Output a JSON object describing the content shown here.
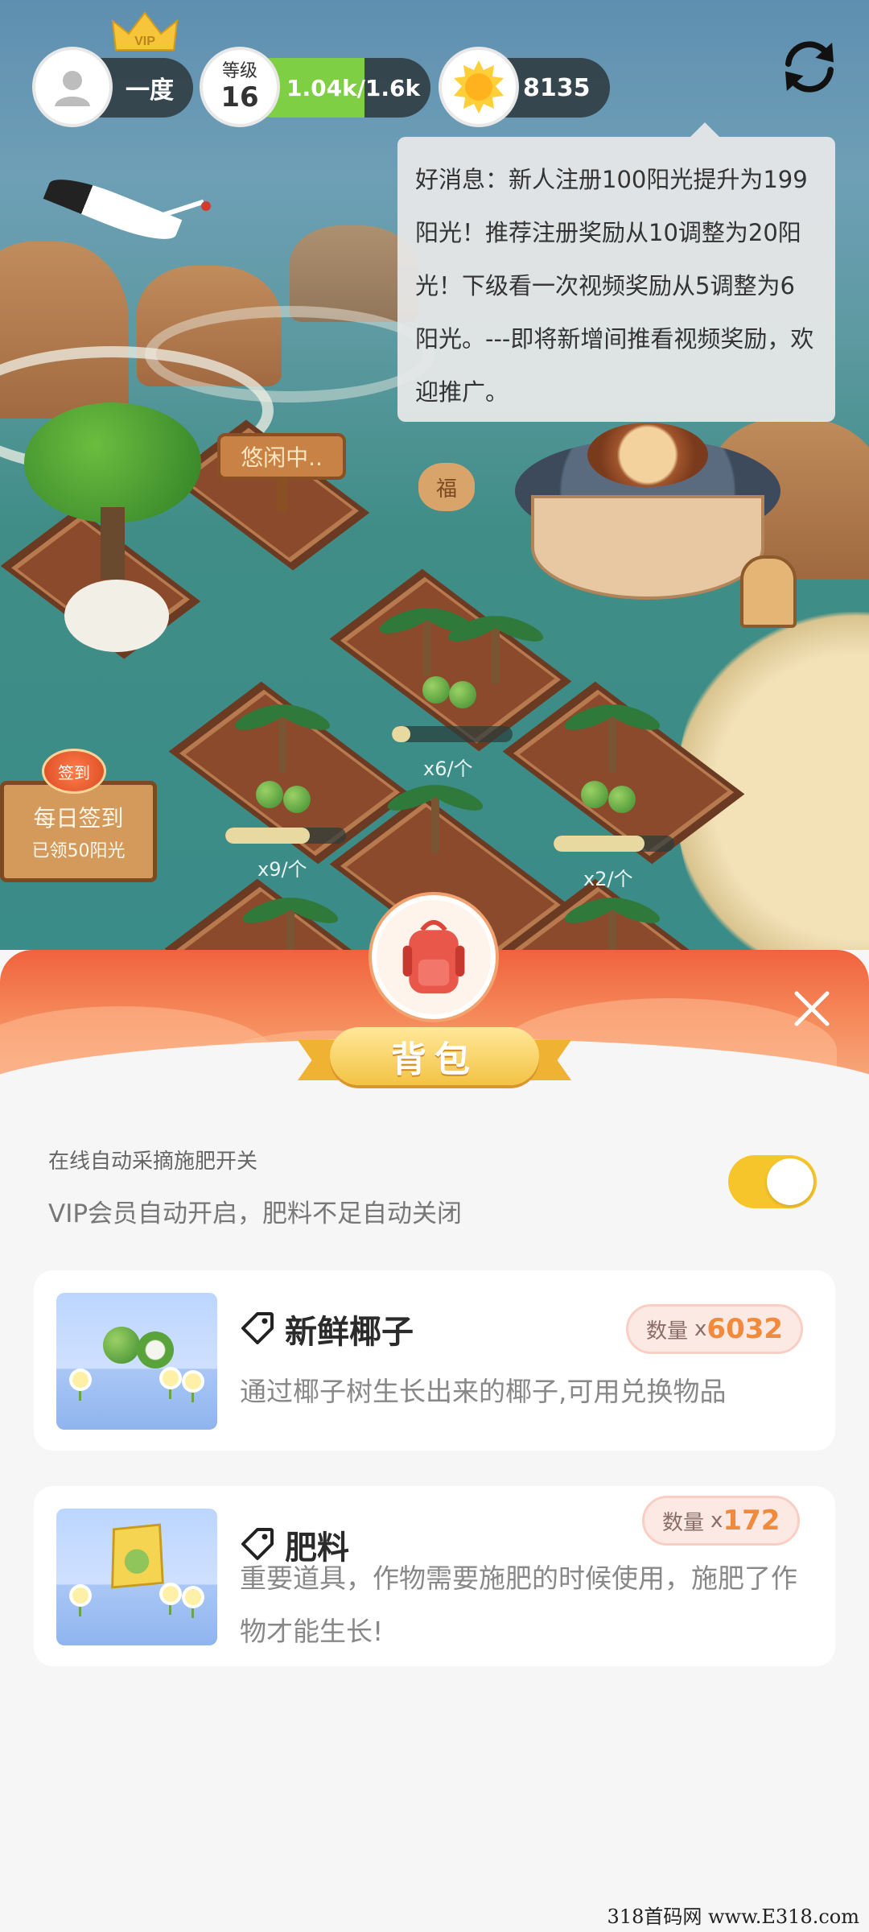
{
  "hud": {
    "user_name": "一度",
    "vip_label": "VIP",
    "level_label": "等级",
    "level_value": "16",
    "xp_text": "1.04k/1.6k",
    "xp_progress": 0.65,
    "sunshine_count": "8135"
  },
  "notice": {
    "text": "好消息：新人注册100阳光提升为199阳光！推荐注册奖励从10调整为20阳光！下级看一次视频奖励从5调整为6阳光。---即将新增间推看视频奖励，欢迎推广。"
  },
  "scene": {
    "idle_sign": "悠闲中..",
    "fu_stone": "福",
    "plots": [
      {
        "count": "x6/个",
        "progress": 0.15
      },
      {
        "count": "x9/个",
        "progress": 0.7
      },
      {
        "count": "x2/个",
        "progress": 0.75
      }
    ],
    "checkin": {
      "badge": "签到",
      "title": "每日签到",
      "subtitle": "已领50阳光"
    }
  },
  "panel": {
    "title": "背包",
    "auto_title": "在线自动采摘施肥开关",
    "auto_desc": "VIP会员自动开启，肥料不足自动关闭",
    "auto_enabled": true,
    "items": [
      {
        "name": "新鲜椰子",
        "qty_label": "数量",
        "qty_prefix": "x",
        "qty_value": "6032",
        "desc": "通过椰子树生长出来的椰子,可用兑换物品"
      },
      {
        "name": "肥料",
        "qty_label": "数量",
        "qty_prefix": "x",
        "qty_value": "172",
        "desc": "重要道具，作物需要施肥的时候使用，施肥了作物才能生长!"
      }
    ]
  },
  "watermark": "318首码网 www.E318.com",
  "colors": {
    "accent_orange": "#f08a3c",
    "xp_green": "#7fcf45",
    "toggle_yellow": "#f6c52b",
    "header_red": "#f0623e"
  }
}
